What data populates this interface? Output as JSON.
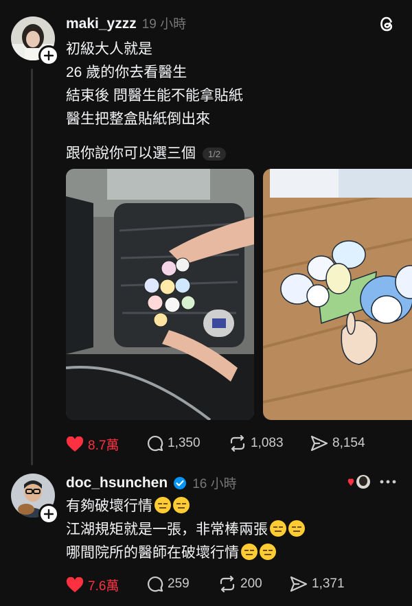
{
  "post": {
    "username": "maki_yzzz",
    "time": "19 小時",
    "lines": [
      "初級大人就是",
      "26 歲的你去看醫生",
      "結束後 問醫生能不能拿貼紙",
      "醫生把整盒貼紙倒出來",
      "",
      "跟你說你可以選三個"
    ],
    "media_counter": "1/2",
    "actions": {
      "likes": "8.7萬",
      "replies": "1,350",
      "reposts": "1,083",
      "shares": "8,154"
    }
  },
  "reply": {
    "username": "doc_hsunchen",
    "time": "16 小時",
    "lines": [
      "有夠破壞行情",
      "江湖規矩就是一張，非常棒兩張",
      "哪間院所的醫師在破壞行情"
    ],
    "actions": {
      "likes": "7.6萬",
      "replies": "259",
      "reposts": "200",
      "shares": "1,371"
    }
  },
  "icons": {
    "app_logo": "threads-logo-icon",
    "like": "heart-filled-icon",
    "reply": "speech-bubble-icon",
    "repost": "repost-icon",
    "share": "send-icon",
    "verified": "verified-badge-icon",
    "more": "more-dots-icon",
    "emoji": "expressionless-face-emoji"
  },
  "colors": {
    "background": "#101010",
    "like_red": "#ff3040",
    "verified_blue": "#0095f6",
    "muted": "#777777"
  }
}
